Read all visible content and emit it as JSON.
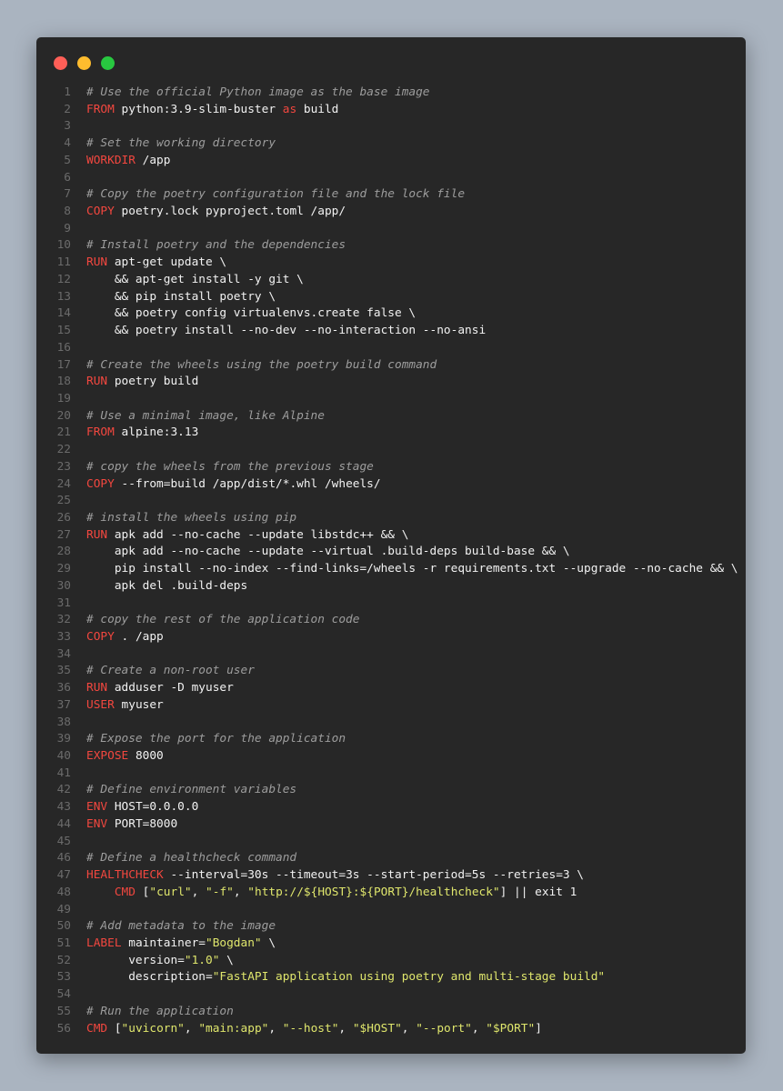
{
  "colors": {
    "background": "#aab4c0",
    "window": "#272727",
    "close_dot": "#ff5f57",
    "minimize_dot": "#febc2e",
    "maximize_dot": "#28c840",
    "line_number": "#6b6b6b",
    "comment": "#9d9d9d",
    "keyword": "#f2473f",
    "string": "#dfe66c",
    "plain": "#f2f2f2"
  },
  "window_controls": [
    "close",
    "minimize",
    "maximize"
  ],
  "code": {
    "language": "dockerfile",
    "lines": [
      [
        [
          "comment",
          "# Use the official Python image as the base image"
        ]
      ],
      [
        [
          "keyword",
          "FROM"
        ],
        [
          "plain",
          " python:3.9-slim-buster "
        ],
        [
          "keyword",
          "as"
        ],
        [
          "plain",
          " build"
        ]
      ],
      [],
      [
        [
          "comment",
          "# Set the working directory"
        ]
      ],
      [
        [
          "keyword",
          "WORKDIR"
        ],
        [
          "plain",
          " /app"
        ]
      ],
      [],
      [
        [
          "comment",
          "# Copy the poetry configuration file and the lock file"
        ]
      ],
      [
        [
          "keyword",
          "COPY"
        ],
        [
          "plain",
          " poetry.lock pyproject.toml /app/"
        ]
      ],
      [],
      [
        [
          "comment",
          "# Install poetry and the dependencies"
        ]
      ],
      [
        [
          "keyword",
          "RUN"
        ],
        [
          "plain",
          " apt-get update \\"
        ]
      ],
      [
        [
          "plain",
          "    && apt-get install -y git \\"
        ]
      ],
      [
        [
          "plain",
          "    && pip install poetry \\"
        ]
      ],
      [
        [
          "plain",
          "    && poetry config virtualenvs.create false \\"
        ]
      ],
      [
        [
          "plain",
          "    && poetry install --no-dev --no-interaction --no-ansi"
        ]
      ],
      [],
      [
        [
          "comment",
          "# Create the wheels using the poetry build command"
        ]
      ],
      [
        [
          "keyword",
          "RUN"
        ],
        [
          "plain",
          " poetry build"
        ]
      ],
      [],
      [
        [
          "comment",
          "# Use a minimal image, like Alpine"
        ]
      ],
      [
        [
          "keyword",
          "FROM"
        ],
        [
          "plain",
          " alpine:3.13"
        ]
      ],
      [],
      [
        [
          "comment",
          "# copy the wheels from the previous stage"
        ]
      ],
      [
        [
          "keyword",
          "COPY"
        ],
        [
          "plain",
          " --from=build /app/dist/*.whl /wheels/"
        ]
      ],
      [],
      [
        [
          "comment",
          "# install the wheels using pip"
        ]
      ],
      [
        [
          "keyword",
          "RUN"
        ],
        [
          "plain",
          " apk add --no-cache --update libstdc++ && \\"
        ]
      ],
      [
        [
          "plain",
          "    apk add --no-cache --update --virtual .build-deps build-base && \\"
        ]
      ],
      [
        [
          "plain",
          "    pip install --no-index --find-links=/wheels -r requirements.txt --upgrade --no-cache && \\"
        ]
      ],
      [
        [
          "plain",
          "    apk del .build-deps"
        ]
      ],
      [],
      [
        [
          "comment",
          "# copy the rest of the application code"
        ]
      ],
      [
        [
          "keyword",
          "COPY"
        ],
        [
          "plain",
          " . /app"
        ]
      ],
      [],
      [
        [
          "comment",
          "# Create a non-root user"
        ]
      ],
      [
        [
          "keyword",
          "RUN"
        ],
        [
          "plain",
          " adduser -D myuser"
        ]
      ],
      [
        [
          "keyword",
          "USER"
        ],
        [
          "plain",
          " myuser"
        ]
      ],
      [],
      [
        [
          "comment",
          "# Expose the port for the application"
        ]
      ],
      [
        [
          "keyword",
          "EXPOSE"
        ],
        [
          "plain",
          " 8000"
        ]
      ],
      [],
      [
        [
          "comment",
          "# Define environment variables"
        ]
      ],
      [
        [
          "keyword",
          "ENV"
        ],
        [
          "plain",
          " HOST=0.0.0.0"
        ]
      ],
      [
        [
          "keyword",
          "ENV"
        ],
        [
          "plain",
          " PORT=8000"
        ]
      ],
      [],
      [
        [
          "comment",
          "# Define a healthcheck command"
        ]
      ],
      [
        [
          "keyword",
          "HEALTHCHECK"
        ],
        [
          "plain",
          " --interval=30s --timeout=3s --start-period=5s --retries=3 \\"
        ]
      ],
      [
        [
          "plain",
          "    "
        ],
        [
          "keyword",
          "CMD"
        ],
        [
          "plain",
          " ["
        ],
        [
          "string",
          "\"curl\""
        ],
        [
          "plain",
          ", "
        ],
        [
          "string",
          "\"-f\""
        ],
        [
          "plain",
          ", "
        ],
        [
          "string",
          "\"http://${HOST}:${PORT}/healthcheck\""
        ],
        [
          "plain",
          "] || exit 1"
        ]
      ],
      [],
      [
        [
          "comment",
          "# Add metadata to the image"
        ]
      ],
      [
        [
          "keyword",
          "LABEL"
        ],
        [
          "plain",
          " maintainer="
        ],
        [
          "string",
          "\"Bogdan\""
        ],
        [
          "plain",
          " \\"
        ]
      ],
      [
        [
          "plain",
          "      version="
        ],
        [
          "string",
          "\"1.0\""
        ],
        [
          "plain",
          " \\"
        ]
      ],
      [
        [
          "plain",
          "      description="
        ],
        [
          "string",
          "\"FastAPI application using poetry and multi-stage build\""
        ]
      ],
      [],
      [
        [
          "comment",
          "# Run the application"
        ]
      ],
      [
        [
          "keyword",
          "CMD"
        ],
        [
          "plain",
          " ["
        ],
        [
          "string",
          "\"uvicorn\""
        ],
        [
          "plain",
          ", "
        ],
        [
          "string",
          "\"main:app\""
        ],
        [
          "plain",
          ", "
        ],
        [
          "string",
          "\"--host\""
        ],
        [
          "plain",
          ", "
        ],
        [
          "string",
          "\"$HOST\""
        ],
        [
          "plain",
          ", "
        ],
        [
          "string",
          "\"--port\""
        ],
        [
          "plain",
          ", "
        ],
        [
          "string",
          "\"$PORT\""
        ],
        [
          "plain",
          "]"
        ]
      ]
    ]
  }
}
